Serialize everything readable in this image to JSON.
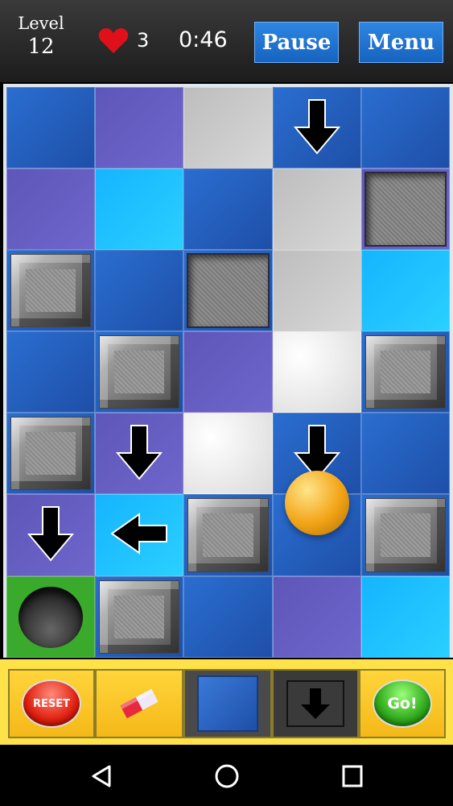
{
  "header": {
    "level_label": "Level",
    "level_value": "12",
    "lives": "3",
    "timer": "0:46",
    "pause_label": "Pause",
    "menu_label": "Menu"
  },
  "board": {
    "rows": 7,
    "cols": 5,
    "cells": [
      [
        {
          "color": "dblue"
        },
        {
          "color": "purple"
        },
        {
          "color": "gray"
        },
        {
          "color": "dblue",
          "item": "arrow-down"
        },
        {
          "color": "dblue"
        }
      ],
      [
        {
          "color": "purple"
        },
        {
          "color": "cyan"
        },
        {
          "color": "dblue"
        },
        {
          "color": "gray"
        },
        {
          "color": "purple",
          "item": "pit"
        }
      ],
      [
        {
          "color": "dblue",
          "item": "stone"
        },
        {
          "color": "dblue"
        },
        {
          "color": "dblue",
          "item": "pit"
        },
        {
          "color": "gray"
        },
        {
          "color": "cyan"
        }
      ],
      [
        {
          "color": "dblue"
        },
        {
          "color": "dblue",
          "item": "stone"
        },
        {
          "color": "purple"
        },
        {
          "color": "white"
        },
        {
          "color": "dblue",
          "item": "stone"
        }
      ],
      [
        {
          "color": "dblue",
          "item": "stone"
        },
        {
          "color": "purple",
          "item": "arrow-down"
        },
        {
          "color": "white"
        },
        {
          "color": "dblue",
          "item": "arrow-down"
        },
        {
          "color": "dblue"
        }
      ],
      [
        {
          "color": "purple",
          "item": "arrow-down"
        },
        {
          "color": "cyan",
          "item": "arrow-left"
        },
        {
          "color": "dblue",
          "item": "stone"
        },
        {
          "color": "dblue"
        },
        {
          "color": "dblue",
          "item": "stone"
        }
      ],
      [
        {
          "color": "green",
          "item": "hole"
        },
        {
          "color": "dblue",
          "item": "stone"
        },
        {
          "color": "dblue"
        },
        {
          "color": "purple"
        },
        {
          "color": "cyan"
        }
      ]
    ],
    "ball_cell": [
      5,
      3
    ]
  },
  "toolbar": {
    "reset_label": "RESET",
    "go_label": "Go!",
    "tools": [
      "reset-button",
      "eraser-tool",
      "blue-tile-tool",
      "down-arrow-tool",
      "go-button"
    ]
  },
  "colors": {
    "accent_blue": "#1e6fd0",
    "toolbar_yellow": "#ffe24a",
    "heart_red": "#e0101a",
    "ball_gold": "#f2a316"
  }
}
